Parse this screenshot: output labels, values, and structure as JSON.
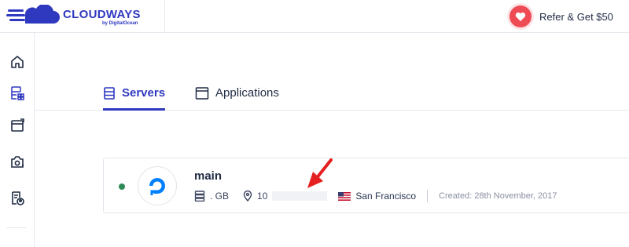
{
  "header": {
    "logo_text": "CLOUDWAYS",
    "logo_sub": "by DigitalOcean",
    "refer_label": "Refer & Get $50"
  },
  "sidebar": {
    "items": [
      {
        "name": "home",
        "icon": "home-icon"
      },
      {
        "name": "servers",
        "icon": "servers-apps-icon",
        "active": true
      },
      {
        "name": "applications",
        "icon": "window-icon"
      },
      {
        "name": "addons",
        "icon": "camera-gear-icon"
      },
      {
        "name": "team",
        "icon": "document-user-icon"
      }
    ]
  },
  "tabs": [
    {
      "label": "Servers",
      "active": true,
      "icon": "server-stack-icon"
    },
    {
      "label": "Applications",
      "active": false,
      "icon": "browser-window-icon"
    }
  ],
  "server": {
    "name": "main",
    "ram": ". GB",
    "ip": "10",
    "region": "San Francisco",
    "created": "Created: 28th November, 2017",
    "status": "running"
  },
  "colors": {
    "brand": "#2f39bf",
    "status_green": "#2e8b57",
    "refer_red": "#ef4b55",
    "annotation_red": "#e52020"
  }
}
